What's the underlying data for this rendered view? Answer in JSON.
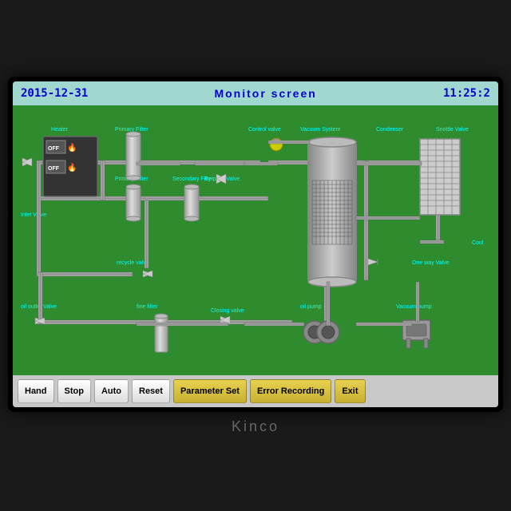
{
  "header": {
    "date": "2015-12-31",
    "title": "Monitor screen",
    "time": "11:25:2"
  },
  "labels": {
    "heater": "Heater",
    "primary_filter": "Primary Filter",
    "primary_filter2": "Primary Filter",
    "secondary_filter": "Secondary Filter",
    "control_valve": "Control valve",
    "vacuum_system": "Vacuum System",
    "condenser": "Condenser",
    "snottle_valve": "Snottle Valve",
    "recycle_valve": "recycle valve",
    "fine_filter": "fine filter",
    "oil_outlet_valve": "oil outlet Valve",
    "closing_valve": "Closing valve",
    "oil_pump": "oil pump",
    "vacuum_pump": "Vacuum pump",
    "by_pass_valve": "By-pass Valve",
    "one_way_valve": "One way Valve",
    "cooling": "Cool",
    "inlet_valve": "Inlet valve",
    "off1": "OFF",
    "off2": "OFF"
  },
  "buttons": [
    {
      "id": "hand",
      "label": "Hand",
      "style": "white"
    },
    {
      "id": "stop",
      "label": "Stop",
      "style": "white"
    },
    {
      "id": "auto",
      "label": "Auto",
      "style": "white"
    },
    {
      "id": "reset",
      "label": "Reset",
      "style": "white"
    },
    {
      "id": "parameter-set",
      "label": "Parameter Set",
      "style": "yellow"
    },
    {
      "id": "error-recording",
      "label": "Error Recording",
      "style": "yellow"
    },
    {
      "id": "exit",
      "label": "Exit",
      "style": "yellow"
    }
  ],
  "brand": "Kinco",
  "colors": {
    "background": "#1a1a1a",
    "screen_bg": "#2e8b2e",
    "header_bg": "#a0d8d0",
    "header_text": "#0000cc",
    "button_bar_bg": "#c8c8c8",
    "pipe_color": "#c0c0c0",
    "label_color": "#00ffff"
  }
}
